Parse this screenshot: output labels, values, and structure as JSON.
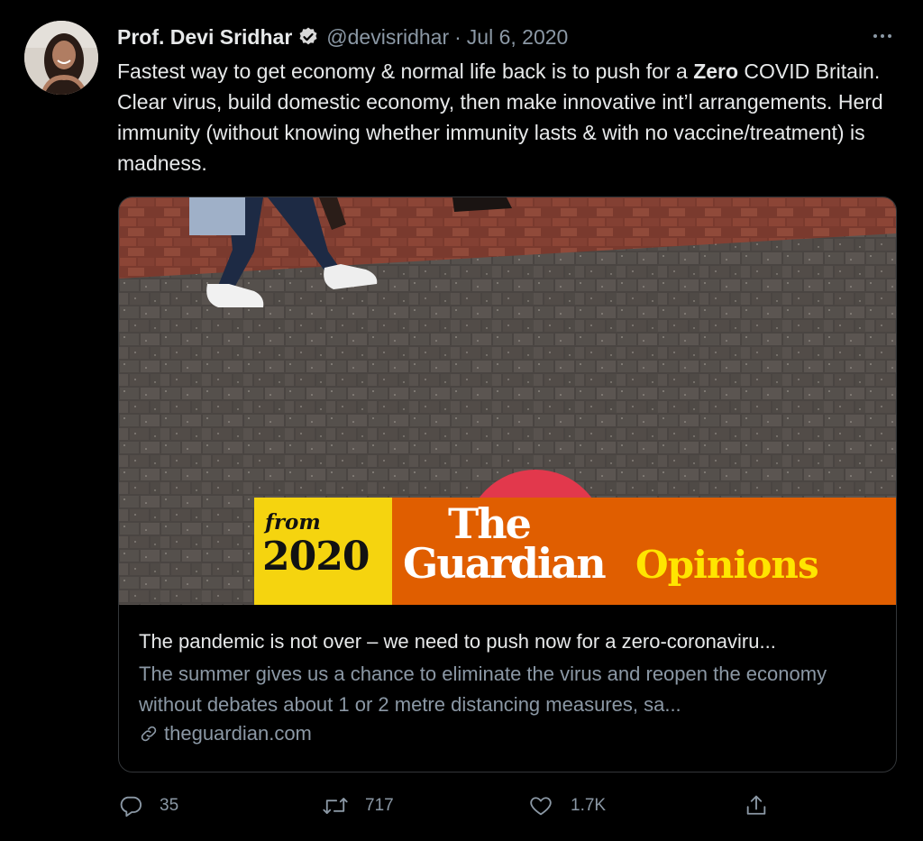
{
  "author": {
    "name": "Prof. Devi Sridhar",
    "handle": "@devisridhar",
    "separator": "·",
    "date": "Jul 6, 2020",
    "verified_icon": "verified-badge-icon"
  },
  "tweet": {
    "text_before_bold": "Fastest way to get economy & normal life back is to push for a ",
    "bold_word": "Zero",
    "text_after_bold": " COVID Britain. Clear virus, build domestic economy, then make innovative int’l arrangements. Herd immunity (without knowing whether immunity lasts & with no vaccine/treatment) is madness."
  },
  "card": {
    "banner": {
      "from_label": "from",
      "year": "2020",
      "brand_line1": "The",
      "brand_line2": "Guardian",
      "section": "Opinions",
      "colors": {
        "yellow": "#f5d40f",
        "orange": "#e05e00",
        "brand_text": "#ffffff",
        "section_text": "#ffe500",
        "year_text": "#121212"
      }
    },
    "title": "The pandemic is not over – we need to push now for a zero-coronaviru...",
    "description": "The summer gives us a chance to eliminate the virus and reopen the economy without debates about 1 or 2 metre distancing measures, sa...",
    "domain": "theguardian.com"
  },
  "actions": {
    "reply_count": "35",
    "retweet_count": "717",
    "like_count": "1.7K"
  },
  "colors": {
    "background": "#000000",
    "text": "#e7e9ea",
    "muted": "#8b98a5",
    "border": "#333639"
  }
}
